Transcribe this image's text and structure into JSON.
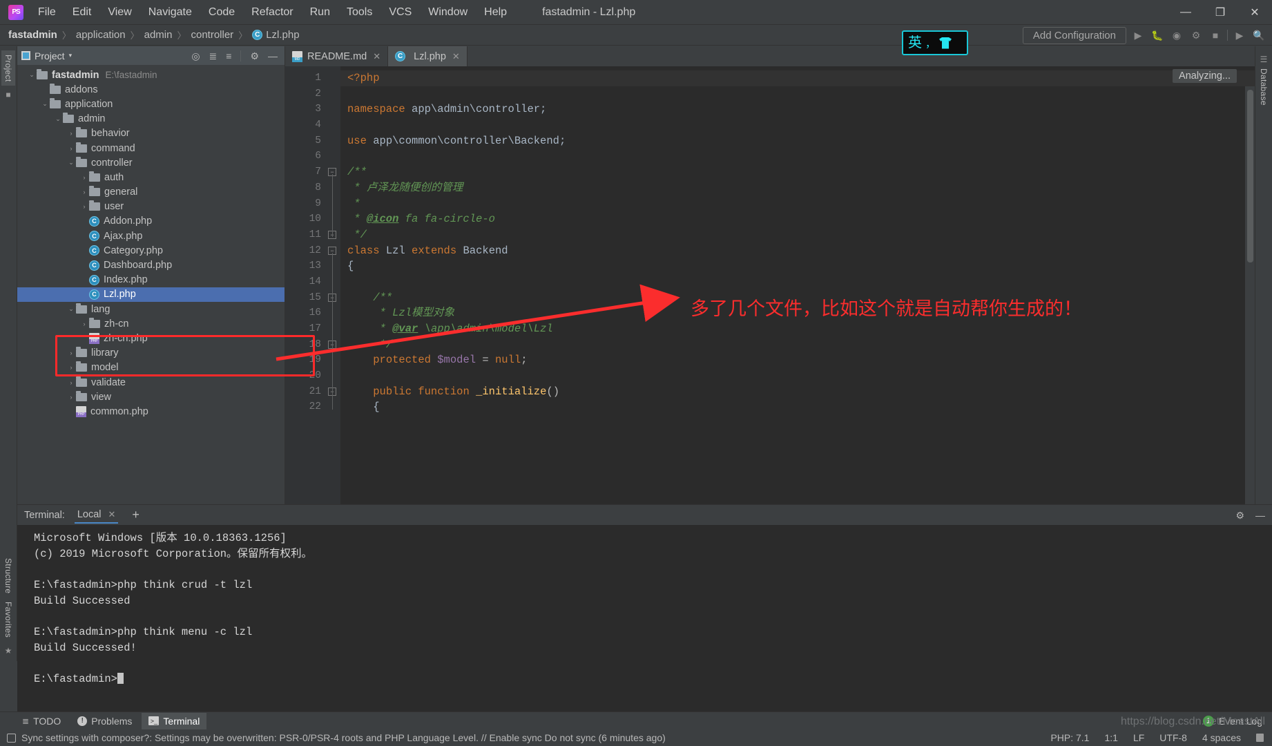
{
  "window": {
    "title": "fastadmin - Lzl.php",
    "minimize": "—",
    "maximize": "❐",
    "close": "✕"
  },
  "menu": {
    "items": [
      "File",
      "Edit",
      "View",
      "Navigate",
      "Code",
      "Refactor",
      "Run",
      "Tools",
      "VCS",
      "Window",
      "Help"
    ]
  },
  "breadcrumb": {
    "items": [
      "fastadmin",
      "application",
      "admin",
      "controller",
      "Lzl.php"
    ],
    "separator": "〉"
  },
  "run_toolbar": {
    "add_configuration": "Add Configuration",
    "icons": [
      "run-icon",
      "debug-icon",
      "coverage-icon",
      "profile-icon",
      "stop-icon",
      "run-anything-icon",
      "search-everywhere-icon"
    ]
  },
  "ime_badge": {
    "language": "英",
    "punctuation": "，",
    "icon": "shirt-icon"
  },
  "left_strip": {
    "tabs": [
      "Project",
      "Structure",
      "Favorites"
    ],
    "selected": "Project"
  },
  "right_strip": {
    "tabs": [
      "Database"
    ]
  },
  "project_panel": {
    "title": "Project",
    "caret": "▾",
    "actions": [
      "locate-icon",
      "expand-all-icon",
      "collapse-all-icon",
      "gear-icon",
      "hide-icon"
    ],
    "tree": [
      {
        "depth": 0,
        "arrow": "⌄",
        "icon": "folder",
        "label": "fastadmin",
        "bold": true,
        "path": "E:\\fastadmin"
      },
      {
        "depth": 1,
        "arrow": "",
        "icon": "folder",
        "label": "addons"
      },
      {
        "depth": 1,
        "arrow": "⌄",
        "icon": "folder",
        "label": "application"
      },
      {
        "depth": 2,
        "arrow": "⌄",
        "icon": "folder",
        "label": "admin"
      },
      {
        "depth": 3,
        "arrow": "›",
        "icon": "folder",
        "label": "behavior"
      },
      {
        "depth": 3,
        "arrow": "›",
        "icon": "folder",
        "label": "command"
      },
      {
        "depth": 3,
        "arrow": "⌄",
        "icon": "folder",
        "label": "controller"
      },
      {
        "depth": 4,
        "arrow": "›",
        "icon": "folder",
        "label": "auth"
      },
      {
        "depth": 4,
        "arrow": "›",
        "icon": "folder",
        "label": "general"
      },
      {
        "depth": 4,
        "arrow": "›",
        "icon": "folder",
        "label": "user"
      },
      {
        "depth": 4,
        "arrow": "",
        "icon": "class",
        "label": "Addon.php"
      },
      {
        "depth": 4,
        "arrow": "",
        "icon": "class",
        "label": "Ajax.php"
      },
      {
        "depth": 4,
        "arrow": "",
        "icon": "class",
        "label": "Category.php"
      },
      {
        "depth": 4,
        "arrow": "",
        "icon": "class",
        "label": "Dashboard.php"
      },
      {
        "depth": 4,
        "arrow": "",
        "icon": "class",
        "label": "Index.php"
      },
      {
        "depth": 4,
        "arrow": "",
        "icon": "class",
        "label": "Lzl.php",
        "selected": true
      },
      {
        "depth": 3,
        "arrow": "⌄",
        "icon": "folder",
        "label": "lang"
      },
      {
        "depth": 4,
        "arrow": "›",
        "icon": "folder",
        "label": "zh-cn"
      },
      {
        "depth": 4,
        "arrow": "",
        "icon": "php",
        "label": "zh-cn.php"
      },
      {
        "depth": 3,
        "arrow": "›",
        "icon": "folder",
        "label": "library"
      },
      {
        "depth": 3,
        "arrow": "›",
        "icon": "folder",
        "label": "model"
      },
      {
        "depth": 3,
        "arrow": "›",
        "icon": "folder",
        "label": "validate"
      },
      {
        "depth": 3,
        "arrow": "›",
        "icon": "folder",
        "label": "view"
      },
      {
        "depth": 3,
        "arrow": "",
        "icon": "php",
        "label": "common.php"
      }
    ]
  },
  "editor": {
    "tabs": [
      {
        "label": "README.md",
        "icon": "markdown-icon",
        "active": false
      },
      {
        "label": "Lzl.php",
        "icon": "class-icon",
        "active": true
      }
    ],
    "status_popup": "Analyzing...",
    "lines": [
      {
        "n": 1,
        "html": "<span class=\"k-kw\">&lt;?php</span>",
        "fold": ""
      },
      {
        "n": 2,
        "html": "",
        "fold": ""
      },
      {
        "n": 3,
        "html": "<span class=\"k-kw\">namespace</span> <span class=\"k-def\">app\\admin\\controller;</span>",
        "fold": ""
      },
      {
        "n": 4,
        "html": "",
        "fold": ""
      },
      {
        "n": 5,
        "html": "<span class=\"k-kw\">use</span> <span class=\"k-def\">app\\common\\controller\\Backend;</span>",
        "fold": ""
      },
      {
        "n": 6,
        "html": "",
        "fold": ""
      },
      {
        "n": 7,
        "html": "<span class=\"k-com\">/**</span>",
        "fold": "open"
      },
      {
        "n": 8,
        "html": "<span class=\"k-com\"> * 卢泽龙随便创的管理</span>",
        "fold": ""
      },
      {
        "n": 9,
        "html": "<span class=\"k-com\"> *</span>",
        "fold": ""
      },
      {
        "n": 10,
        "html": "<span class=\"k-com\"> * </span><span class=\"k-tag\">@icon</span><span class=\"k-com\"> fa fa-circle-o</span>",
        "fold": ""
      },
      {
        "n": 11,
        "html": "<span class=\"k-com\"> */</span>",
        "fold": "close"
      },
      {
        "n": 12,
        "html": "<span class=\"k-kw\">class</span> <span class=\"k-cls\">Lzl</span> <span class=\"k-kw\">extends</span> <span class=\"k-cls\">Backend</span>",
        "fold": "open"
      },
      {
        "n": 13,
        "html": "<span class=\"k-def\">{</span>",
        "fold": ""
      },
      {
        "n": 14,
        "html": "",
        "fold": ""
      },
      {
        "n": 15,
        "html": "    <span class=\"k-com\">/**</span>",
        "fold": "open"
      },
      {
        "n": 16,
        "html": "     <span class=\"k-com\">* Lzl模型对象</span>",
        "fold": ""
      },
      {
        "n": 17,
        "html": "     <span class=\"k-com\">* </span><span class=\"k-tag\">@var</span><span class=\"k-com\"> \\app\\admin\\model\\Lzl</span>",
        "fold": ""
      },
      {
        "n": 18,
        "html": "     <span class=\"k-com\">*/</span>",
        "fold": "close"
      },
      {
        "n": 19,
        "html": "    <span class=\"k-kw\">protected</span> <span class=\"k-var\">$model</span> = <span class=\"k-kw\">null</span>;",
        "fold": "",
        "mark": "override"
      },
      {
        "n": 20,
        "html": "",
        "fold": ""
      },
      {
        "n": 21,
        "html": "    <span class=\"k-kw\">public function</span> <span class=\"k-fn\">_initialize</span>()",
        "fold": "open",
        "mark": "override"
      },
      {
        "n": 22,
        "html": "    <span class=\"k-def\">{</span>",
        "fold": ""
      }
    ]
  },
  "terminal": {
    "label": "Terminal:",
    "tab": "Local",
    "close": "✕",
    "add": "+",
    "actions": [
      "settings-gear-icon",
      "hide-icon"
    ],
    "output": [
      "Microsoft Windows [版本 10.0.18363.1256]",
      "(c) 2019 Microsoft Corporation。保留所有权利。",
      "",
      "E:\\fastadmin>php think crud -t lzl",
      "Build Successed",
      "",
      "E:\\fastadmin>php think menu -c lzl",
      "Build Successed!",
      "",
      "E:\\fastadmin>"
    ]
  },
  "bottom_bar": {
    "tabs": [
      {
        "label": "TODO",
        "icon": "todo-icon",
        "selected": false
      },
      {
        "label": "Problems",
        "icon": "problems-icon",
        "selected": false
      },
      {
        "label": "Terminal",
        "icon": "terminal-icon",
        "selected": true
      }
    ],
    "event_log": {
      "count": "1",
      "label": "Event Log"
    }
  },
  "status_bar": {
    "message": "Sync settings with composer?: Settings may be overwritten: PSR-0/PSR-4 roots and PHP Language Level. // Enable sync   Do not sync (6 minutes ago)",
    "php_version": "PHP: 7.1",
    "caret": "1:1",
    "line_sep": "LF",
    "encoding": "UTF-8",
    "indent": "4 spaces",
    "lock": "lock-icon"
  },
  "annotations": {
    "callout_text": "多了几个文件，比如这个就是自动帮你生成的！",
    "highlight_color": "#ff2a2a"
  },
  "watermark": "https://blog.csdn.net/MoastAll"
}
